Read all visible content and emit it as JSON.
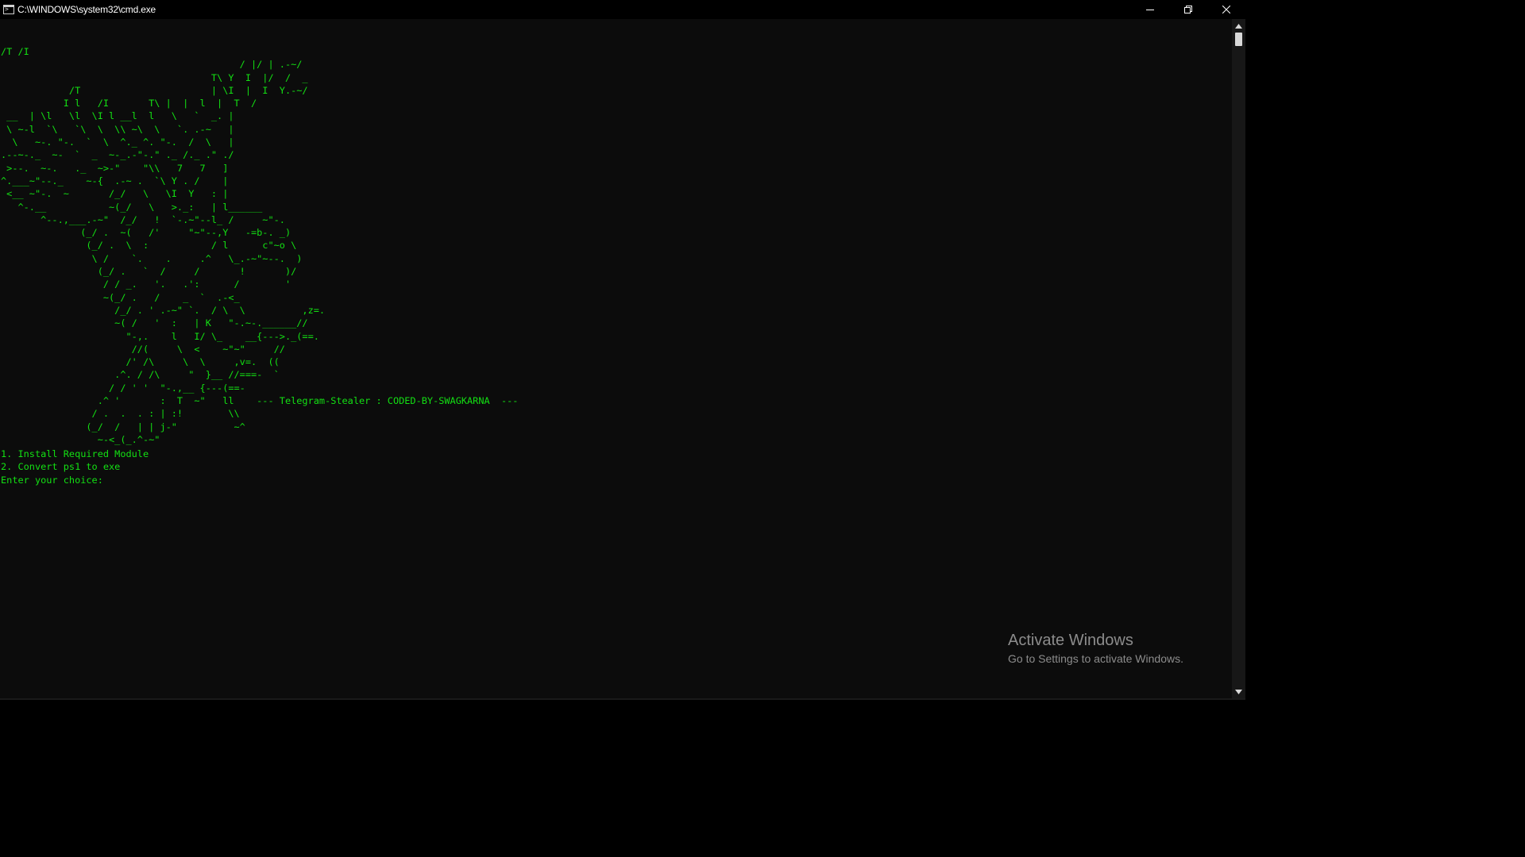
{
  "window": {
    "title": "C:\\WINDOWS\\system32\\cmd.exe",
    "icon": "cmd-icon",
    "controls": {
      "minimize": "minimize-icon",
      "restore": "restore-icon",
      "close": "close-icon"
    }
  },
  "console": {
    "text_color": "#13e013",
    "background_color": "#0c0c0c",
    "ascii_art": "/T /I\n                                          / |/ | .-~/\n                                     T\\ Y  I  |/  /  _\n            /T                       | \\I  |  I  Y.-~/\n           I l   /I       T\\ |  |  l  |  T  /\n __  | \\l   \\l  \\I l __l  l   \\   `  _. |\n \\ ~-l  `\\   `\\  \\  \\\\ ~\\  \\   `. .-~   |\n  \\   ~-. \"-.  `  \\  ^._ ^. \"-.  /  \\   |\n.--~-._  ~-  `  _  ~-_.-\"-.\" ._ /._ .\" ./\n >--.  ~-.   ._  ~>-\"    \"\\\\   7   7   ]\n^.___~\"--._    ~-{  .-~ .  `\\ Y . /    |\n <__ ~\"-.  ~       /_/   \\   \\I  Y   : |\n   ^-.__           ~(_/   \\   >._:   | l______\n       ^--.,___.-~\"  /_/   !  `-.~\"--l_ /     ~\"-.\n              (_/ .  ~(   /'     \"~\"--,Y   -=b-. _)\n               (_/ .  \\  :           / l      c\"~o \\\n                \\ /    `.    .     .^   \\_.-~\"~--.  )\n                 (_/ .   `  /     /       !       )/\n                  / / _.   '.   .':      /        '\n                  ~(_/ .   /    _  `  .-<_\n                    /_/ . ' .-~\" `.  / \\  \\          ,z=.\n                    ~( /   '  :   | K   \"-.~-.______//\n                      \"-,.    l   I/ \\_    __{--->._(==.\n                       //(     \\  <    ~\"~\"     //\n                      /' /\\     \\  \\     ,v=.  ((\n                    .^. / /\\     \"  }__ //===-  `\n                   / / ' '  \"-.,__ {---(==-\n                 .^ '       :  T  ~\"   ll    --- Telegram-Stealer : CODED-BY-SWAGKARNA  ---\n                / .  .  . : | :!        \\\\\n               (_/  /   | | j-\"          ~^\n                 ~-<_(_.^-~\"",
    "menu_options": [
      "1. Install Required Module",
      "2. Convert ps1 to exe"
    ],
    "prompt": "Enter your choice: "
  },
  "watermark": {
    "title": "Activate Windows",
    "subtitle": "Go to Settings to activate Windows."
  }
}
